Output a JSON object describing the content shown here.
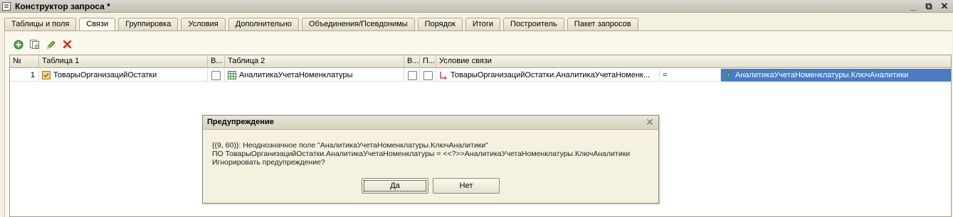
{
  "window": {
    "title": "Конструктор запроса *",
    "controls": [
      "_",
      "⧉",
      "✕"
    ]
  },
  "tabs": [
    {
      "label": "Таблицы и поля",
      "active": false
    },
    {
      "label": "Связи",
      "active": true
    },
    {
      "label": "Группировка",
      "active": false
    },
    {
      "label": "Условия",
      "active": false
    },
    {
      "label": "Дополнительно",
      "active": false
    },
    {
      "label": "Объединения/Псевдонимы",
      "active": false
    },
    {
      "label": "Порядок",
      "active": false
    },
    {
      "label": "Итоги",
      "active": false
    },
    {
      "label": "Построитель",
      "active": false
    },
    {
      "label": "Пакет запросов",
      "active": false
    }
  ],
  "toolbar": {
    "icons": [
      "add-icon",
      "copy-icon",
      "edit-icon",
      "delete-icon"
    ]
  },
  "grid": {
    "headers": [
      "№",
      "Таблица 1",
      "В...",
      "Таблица 2",
      "В...",
      "П...",
      "Условие связи"
    ],
    "row": {
      "num": "1",
      "table1": "ТоварыОрганизацийОстатки",
      "table2": "АналитикаУчетаНоменклатуры",
      "cond_left": "ТоварыОрганизацийОстатки.АналитикаУчетаНоменк...",
      "cond_op": "=",
      "cond_right": "АналитикаУчетаНоменклатуры.КлючАналитики"
    }
  },
  "dialog": {
    "title": "Предупреждение",
    "lines": [
      "{(9, 60)}: Неоднозначное поле \"АналитикаУчетаНоменклатуры.КлючАналитики\"",
      "ПО ТоварыОрганизацийОстатки.АналитикаУчетаНоменклатуры = <<?>>АналитикаУчетаНоменклатуры.КлючАналитики",
      "Игнорировать предупреждение?"
    ],
    "yes": "Да",
    "no": "Нет"
  },
  "colors": {
    "selection": "#4a7bc4",
    "background": "#f4f1e0"
  }
}
